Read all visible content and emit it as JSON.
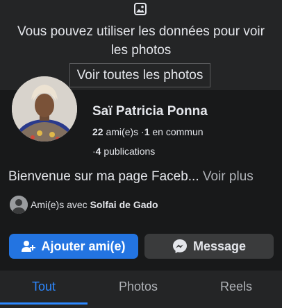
{
  "photos_notice": {
    "icon": "image-icon",
    "text_line1": "Vous pouvez utiliser les données pour voir",
    "text_line2": "les photos",
    "button_label": "Voir toutes les photos"
  },
  "profile": {
    "name": "Saï Patricia Ponna",
    "friends_count": "22",
    "friends_label": "ami(e)s",
    "mutual_count": "1",
    "mutual_label": "en commun",
    "posts_count": "4",
    "posts_label": "publications",
    "bio": "Bienvenue sur ma page Faceb...",
    "see_more": "Voir plus",
    "mutual_friend_prefix": "Ami(e)s avec",
    "mutual_friend_name": "Solfai de Gado"
  },
  "actions": {
    "add_friend_label": "Ajouter ami(e)",
    "add_friend_icon": "add-person-icon",
    "message_label": "Message",
    "message_icon": "messenger-icon"
  },
  "tabs": [
    {
      "label": "Tout",
      "active": true
    },
    {
      "label": "Photos",
      "active": false
    },
    {
      "label": "Reels",
      "active": false
    }
  ],
  "colors": {
    "accent": "#2374e1",
    "active_tab": "#2d88ff",
    "background": "#18191a",
    "panel": "#242526"
  }
}
